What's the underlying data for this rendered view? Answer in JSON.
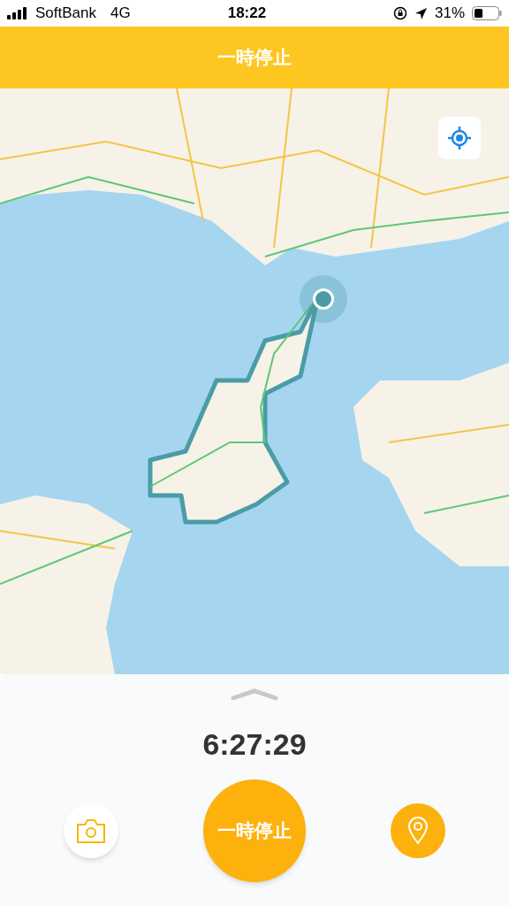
{
  "status_bar": {
    "carrier": "SoftBank",
    "network": "4G",
    "time": "18:22",
    "battery": "31%"
  },
  "header": {
    "title": "一時停止"
  },
  "panel": {
    "elapsed": "6:27:29",
    "pause_button": "一時停止"
  }
}
